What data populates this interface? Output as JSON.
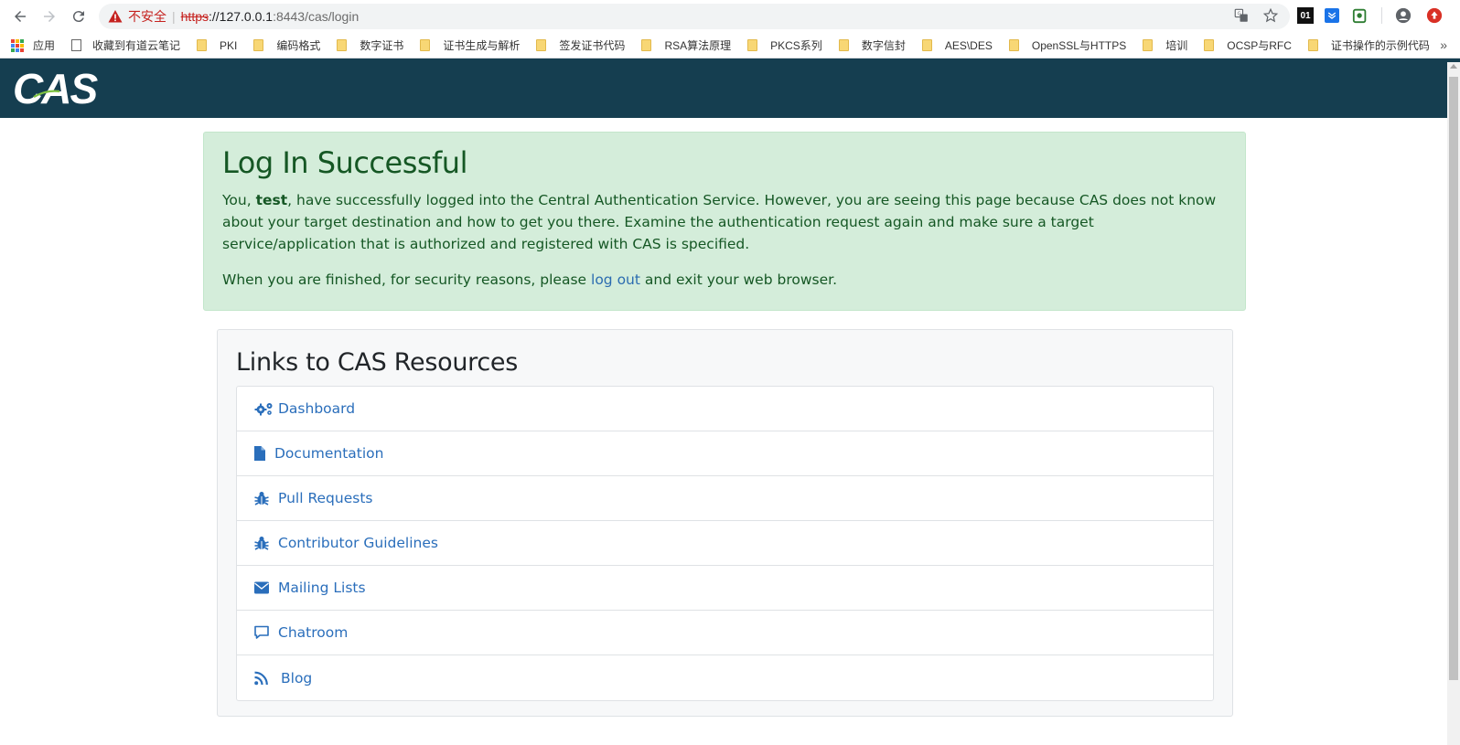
{
  "browser": {
    "insecure_label": "不安全",
    "url_scheme": "https",
    "url_host": "://127.0.0.1",
    "url_rest": ":8443/cas/login",
    "ext_01_label": "01"
  },
  "bookmarks": [
    {
      "label": "应用",
      "icon": "apps-icon"
    },
    {
      "label": "收藏到有道云笔记",
      "icon": "page-icon"
    },
    {
      "label": "PKI",
      "icon": "folder-icon"
    },
    {
      "label": "编码格式",
      "icon": "folder-icon"
    },
    {
      "label": "数字证书",
      "icon": "folder-icon"
    },
    {
      "label": "证书生成与解析",
      "icon": "folder-icon"
    },
    {
      "label": "签发证书代码",
      "icon": "folder-icon"
    },
    {
      "label": "RSA算法原理",
      "icon": "folder-icon"
    },
    {
      "label": "PKCS系列",
      "icon": "folder-icon"
    },
    {
      "label": "数字信封",
      "icon": "folder-icon"
    },
    {
      "label": "AES\\DES",
      "icon": "folder-icon"
    },
    {
      "label": "OpenSSL与HTTPS",
      "icon": "folder-icon"
    },
    {
      "label": "培训",
      "icon": "folder-icon"
    },
    {
      "label": "OCSP与RFC",
      "icon": "folder-icon"
    },
    {
      "label": "证书操作的示例代码",
      "icon": "folder-icon"
    }
  ],
  "bookmarks_more": "»",
  "header": {
    "logo_text": "CAS",
    "bg_color": "#153e50"
  },
  "success": {
    "title": "Log In Successful",
    "p1_pre": "You, ",
    "p1_user": "test",
    "p1_post": ", have successfully logged into the Central Authentication Service. However, you are seeing this page because CAS does not know about your target destination and how to get you there. Examine the authentication request again and make sure a target service/application that is authorized and registered with CAS is specified.",
    "p2_pre": "When you are finished, for security reasons, please ",
    "p2_link": "log out",
    "p2_post": " and exit your web browser."
  },
  "resources": {
    "title": "Links to CAS Resources",
    "items": [
      {
        "label": "Dashboard",
        "icon": "gears-icon"
      },
      {
        "label": "Documentation",
        "icon": "file-icon"
      },
      {
        "label": "Pull Requests",
        "icon": "bug-icon"
      },
      {
        "label": "Contributor Guidelines",
        "icon": "bug-icon"
      },
      {
        "label": "Mailing Lists",
        "icon": "envelope-icon"
      },
      {
        "label": "Chatroom",
        "icon": "comment-icon"
      },
      {
        "label": "Blog",
        "icon": "rss-icon"
      }
    ]
  },
  "colors": {
    "success_bg": "#d4edda",
    "success_text": "#155724",
    "link": "#2a6ebb"
  }
}
